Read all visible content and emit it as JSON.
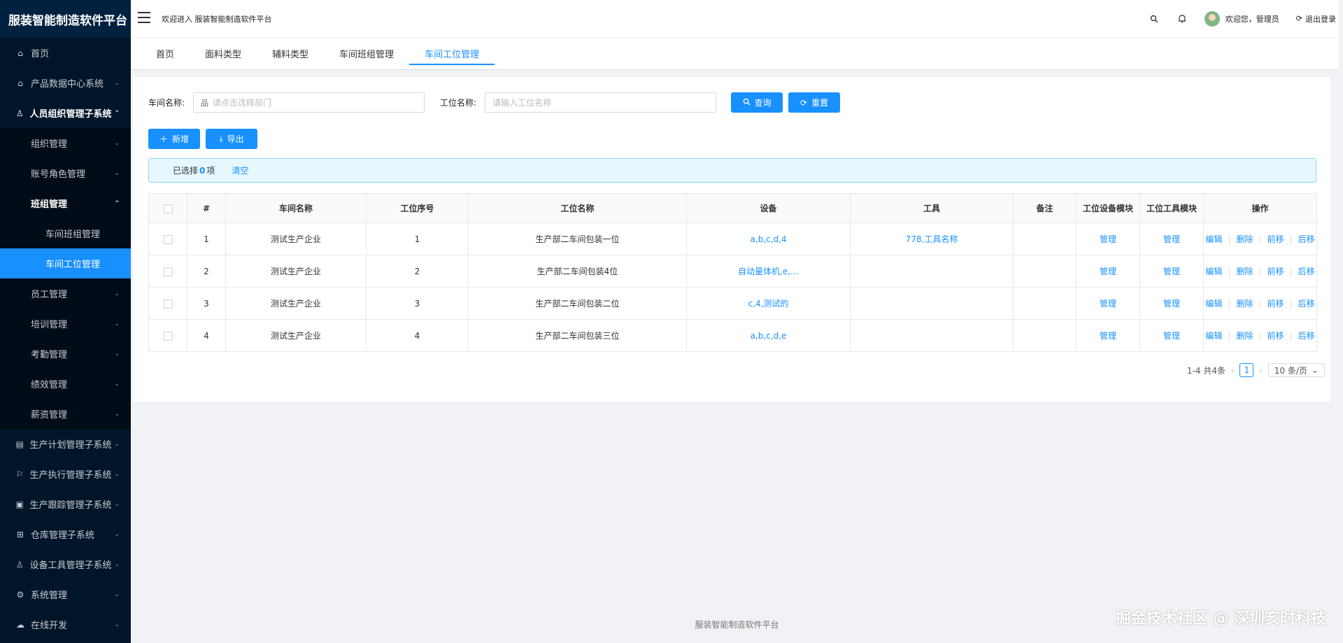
{
  "app": {
    "title": "服装智能制造软件平台",
    "welcome": "欢迎进入 服装智能制造软件平台",
    "user_greeting": "欢迎您，管理员",
    "logout": "退出登录",
    "footer": "服装智能制造软件平台",
    "watermark": "掘金技术社区 @ 深圳亥时科技"
  },
  "sidebar": {
    "items": [
      {
        "label": "首页",
        "icon": "home-icon"
      },
      {
        "label": "产品数据中心系统",
        "icon": "bank-icon"
      },
      {
        "label": "人员组织管理子系统",
        "icon": "user-icon"
      },
      {
        "label": "组织管理"
      },
      {
        "label": "账号角色管理"
      },
      {
        "label": "班组管理"
      },
      {
        "label": "车间班组管理"
      },
      {
        "label": "车间工位管理"
      },
      {
        "label": "员工管理"
      },
      {
        "label": "培训管理"
      },
      {
        "label": "考勤管理"
      },
      {
        "label": "绩效管理"
      },
      {
        "label": "薪资管理"
      },
      {
        "label": "生产计划管理子系统",
        "icon": "plan-icon"
      },
      {
        "label": "生产执行管理子系统",
        "icon": "flag-icon"
      },
      {
        "label": "生产跟踪管理子系统",
        "icon": "track-icon"
      },
      {
        "label": "仓库管理子系统",
        "icon": "grid-icon"
      },
      {
        "label": "设备工具管理子系统",
        "icon": "tool-icon"
      },
      {
        "label": "系统管理",
        "icon": "gear-icon"
      },
      {
        "label": "在线开发",
        "icon": "cloud-icon"
      }
    ]
  },
  "tabs": [
    "首页",
    "面料类型",
    "辅料类型",
    "车间班组管理",
    "车间工位管理"
  ],
  "search": {
    "workshop_label": "车间名称:",
    "workshop_placeholder": "请点击选择部门",
    "station_label": "工位名称:",
    "station_placeholder": "请输入工位名称",
    "query": "查询",
    "reset": "重置"
  },
  "actions": {
    "add": "新增",
    "export": "导出"
  },
  "alert": {
    "prefix": "已选择",
    "count": "0",
    "suffix": "项",
    "clear": "清空"
  },
  "table": {
    "headers": [
      "#",
      "车间名称",
      "工位序号",
      "工位名称",
      "设备",
      "工具",
      "备注",
      "工位设备模块",
      "工位工具模块",
      "操作"
    ],
    "rows": [
      {
        "no": "1",
        "workshop": "测试生产企业",
        "seq": "1",
        "name": "生产部二车间包装一位",
        "equipment": "a,b,c,d,4",
        "tool": "778,工具名称",
        "remark": ""
      },
      {
        "no": "2",
        "workshop": "测试生产企业",
        "seq": "2",
        "name": "生产部二车间包装4位",
        "equipment": "自动量体机,e,…",
        "tool": "",
        "remark": ""
      },
      {
        "no": "3",
        "workshop": "测试生产企业",
        "seq": "3",
        "name": "生产部二车间包装二位",
        "equipment": "c,4,测试的",
        "tool": "",
        "remark": ""
      },
      {
        "no": "4",
        "workshop": "测试生产企业",
        "seq": "4",
        "name": "生产部二车间包装三位",
        "equipment": "a,b,c,d,e",
        "tool": "",
        "remark": ""
      }
    ],
    "manage": "管理",
    "ops": {
      "edit": "编辑",
      "delete": "删除",
      "up": "前移",
      "down": "后移"
    }
  },
  "pager": {
    "summary": "1-4 共4条",
    "current": "1",
    "page_size": "10 条/页"
  },
  "colors": {
    "primary": "#1890ff",
    "sidebar_bg": "#001529",
    "submenu_bg": "#000c17"
  }
}
